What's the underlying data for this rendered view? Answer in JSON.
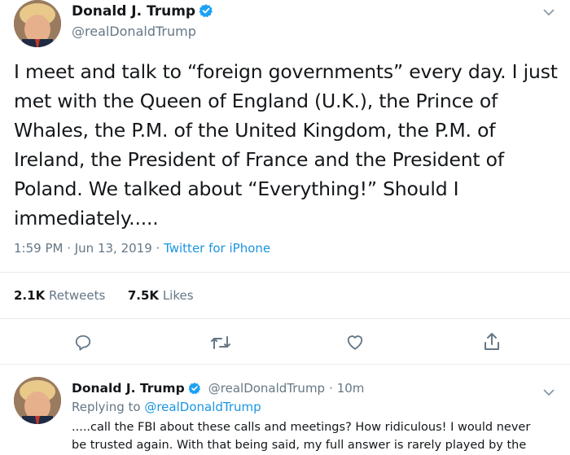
{
  "tweet": {
    "author_name": "Donald J. Trump",
    "author_handle": "@realDonaldTrump",
    "text_lines": [
      "I meet and talk to “foreign governments” every day. I just",
      "met with the Queen of England (U.K.), the Prince of",
      "Whales, the P.M. of the United Kingdom, the P.M. of",
      "Ireland, the President of France and the President of",
      "Poland. We talked about “Everything!” Should I",
      "immediately....."
    ],
    "timestamp": "1:59 PM · Jun 13, 2019 · ",
    "source": "Twitter for iPhone",
    "retweets_count": "2.1K",
    "retweets_label": "Retweets",
    "likes_count": "7.5K",
    "likes_label": "Likes"
  },
  "actions": {
    "reply_icon": "speech-bubble-icon",
    "retweet_icon": "retweet-icon",
    "like_icon": "heart-icon",
    "share_icon": "share-icon"
  },
  "reply": {
    "author_name": "Donald J. Trump",
    "author_handle": "@realDonaldTrump",
    "time_ago": "· 10m",
    "replying_prefix": "Replying to ",
    "replying_handle": "@realDonaldTrump",
    "text_lines": [
      ".....call the FBI about these calls and meetings? How ridiculous! I would never",
      "be trusted again. With that being said, my full answer is rarely played by the"
    ]
  },
  "colors": {
    "verified_blue": "#1da1f2",
    "link_blue": "#1b95e0",
    "secondary_gray": "#657786"
  }
}
